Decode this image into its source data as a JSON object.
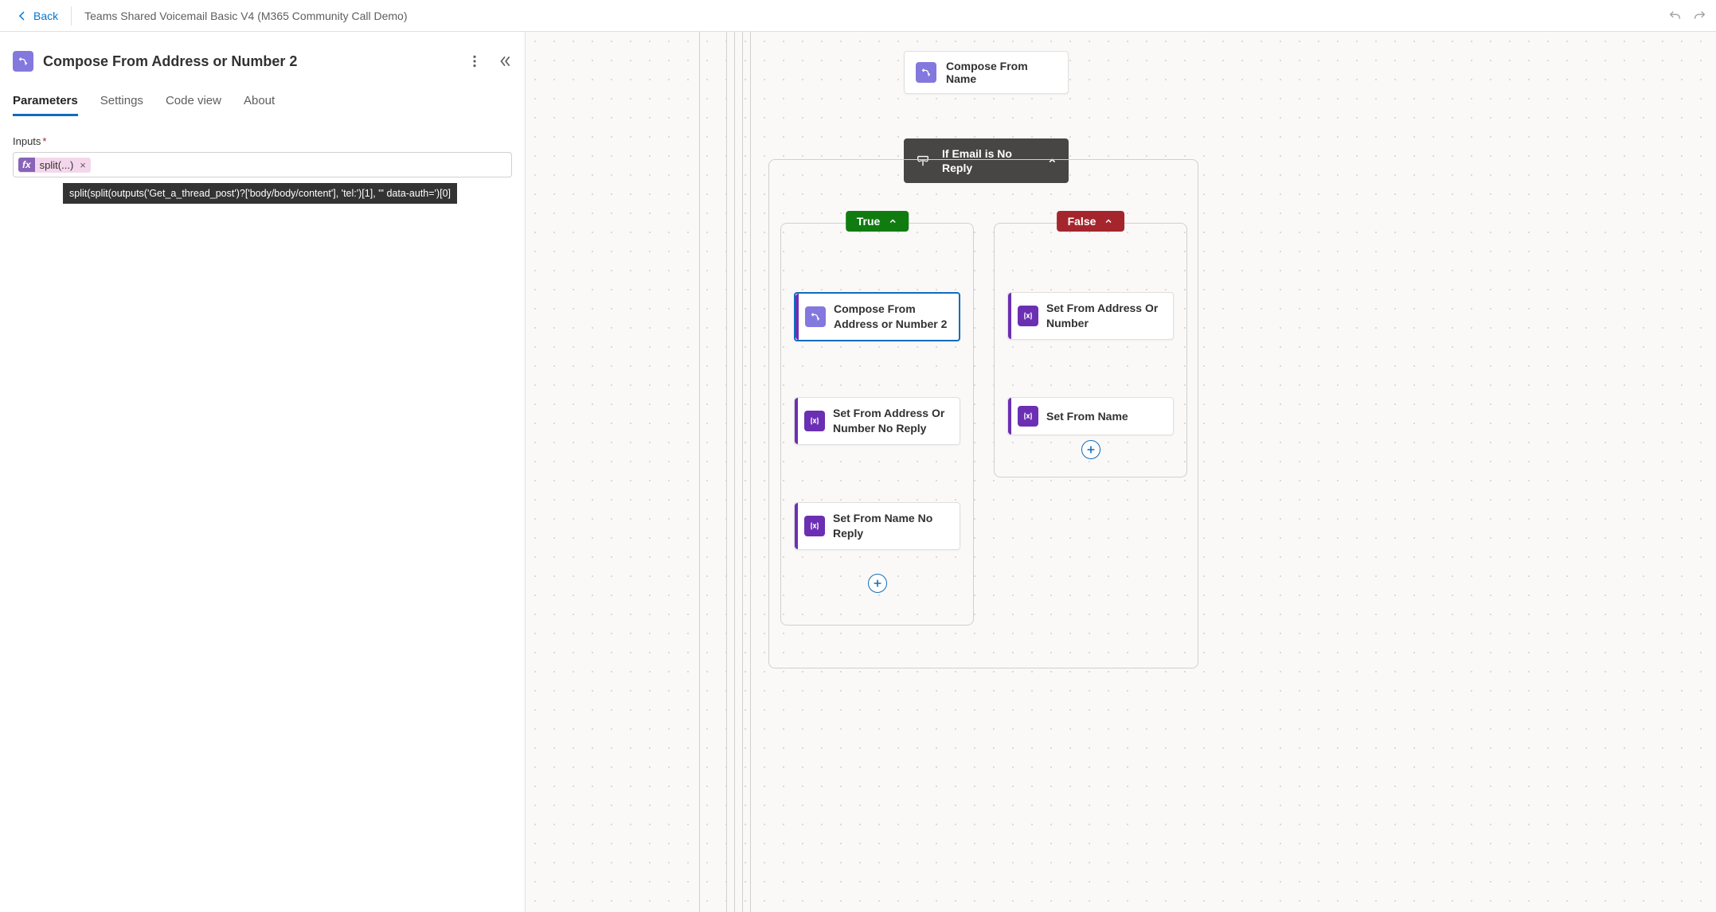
{
  "topbar": {
    "back": "Back",
    "title": "Teams Shared Voicemail Basic V4 (M365 Community Call Demo)"
  },
  "panel": {
    "title": "Compose From Address or Number 2",
    "tabs": {
      "parameters": "Parameters",
      "settings": "Settings",
      "codeview": "Code view",
      "about": "About"
    },
    "inputs_label": "Inputs",
    "token_fx": "fx",
    "token_text": "split(...)",
    "token_close": "×",
    "tooltip": "split(split(outputs('Get_a_thread_post')?['body/body/content'], 'tel:')[1], '\" data-auth=')[0]"
  },
  "canvas": {
    "compose_from_name": "Compose From Name",
    "condition_title": "If Email is No Reply",
    "true_label": "True",
    "false_label": "False",
    "true_branch": {
      "n1": "Compose From Address or Number 2",
      "n2": "Set From Address Or Number No Reply",
      "n3": "Set From Name No Reply"
    },
    "false_branch": {
      "n1": "Set From Address Or Number",
      "n2": "Set From Name"
    }
  }
}
